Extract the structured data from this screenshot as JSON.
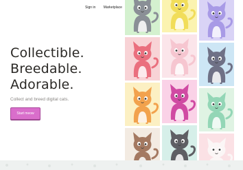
{
  "nav": {
    "sign_in": "Sign in",
    "marketplace": "Marketplace"
  },
  "hero": {
    "line1": "Collectible.",
    "line2": "Breedable.",
    "line3": "Adorable.",
    "tagline": "Collect and breed digital cats.",
    "cta": "Start meow"
  },
  "colors": {
    "cta_bg": "#d96ecb",
    "headline": "#2a2825"
  },
  "tiles": [
    {
      "name": "cat-tile-grey-on-green",
      "bg": "#d4f1cf",
      "cat": "#8a8f96",
      "icon": "cat-icon"
    },
    {
      "name": "cat-tile-yellow-on-yellow",
      "bg": "#fbf3b0",
      "cat": "#f1dd5a",
      "icon": "cat-icon"
    },
    {
      "name": "cat-tile-lavender-on-lavender",
      "bg": "#d9d3f6",
      "cat": "#a89ae6",
      "icon": "cat-icon"
    },
    {
      "name": "cat-tile-red-on-pink",
      "bg": "#f8d3d6",
      "cat": "#ea6f7e",
      "icon": "cat-icon"
    },
    {
      "name": "cat-tile-pink-on-pink",
      "bg": "#fbe5ea",
      "cat": "#f6c6d0",
      "icon": "cat-icon"
    },
    {
      "name": "cat-tile-slate-on-blue",
      "bg": "#cde6f5",
      "cat": "#6f7186",
      "icon": "cat-icon"
    },
    {
      "name": "cat-tile-orange-on-yellow",
      "bg": "#fcf0c3",
      "cat": "#f2a24d",
      "icon": "cat-icon"
    },
    {
      "name": "cat-tile-magenta-on-pink",
      "bg": "#fad2e7",
      "cat": "#d04aa3",
      "icon": "cat-icon"
    },
    {
      "name": "cat-tile-mint-on-green",
      "bg": "#dff3e3",
      "cat": "#93d6b6",
      "icon": "cat-icon"
    },
    {
      "name": "cat-tile-brown-on-cream",
      "bg": "#f3ebe2",
      "cat": "#a47961",
      "icon": "cat-icon"
    },
    {
      "name": "cat-tile-charcoal-on-mint",
      "bg": "#d6efe9",
      "cat": "#5e5f64",
      "icon": "cat-icon"
    },
    {
      "name": "cat-tile-white-on-rose",
      "bg": "#fbe1e5",
      "cat": "#fbf6f6",
      "icon": "cat-icon"
    }
  ]
}
